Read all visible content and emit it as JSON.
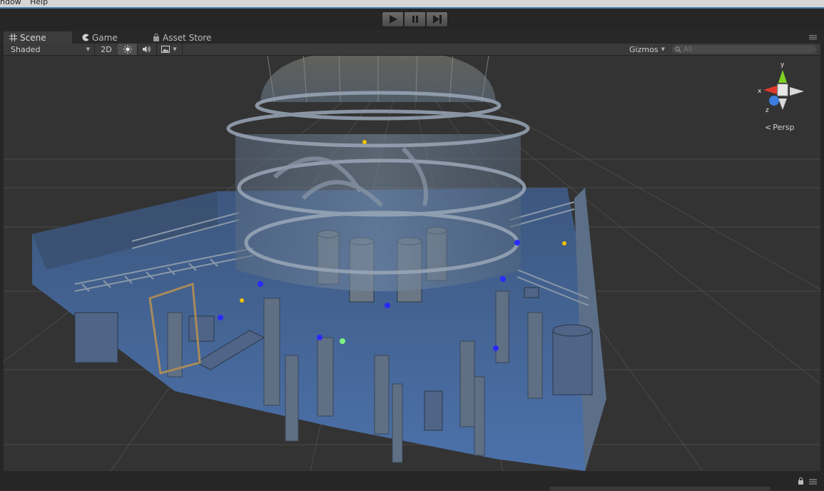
{
  "menu": {
    "items": [
      "ndow",
      "Help"
    ]
  },
  "play_controls": {
    "play": "play-icon",
    "pause": "pause-icon",
    "step": "step-icon"
  },
  "tabs": [
    {
      "label": "Scene",
      "icon": "scene-grid-icon",
      "active": true
    },
    {
      "label": "Game",
      "icon": "game-pacman-icon",
      "active": false
    },
    {
      "label": "Asset Store",
      "icon": "asset-store-bag-icon",
      "active": false
    }
  ],
  "scene_toolbar": {
    "render_mode": "Shaded",
    "mode_2d": "2D",
    "lighting_icon": "sun-icon",
    "audio_icon": "speaker-icon",
    "effects_icon": "image-icon",
    "gizmos_label": "Gizmos",
    "search_placeholder": "All"
  },
  "viewport": {
    "projection_label": "Persp",
    "axis_labels": {
      "x": "x",
      "y": "y",
      "z": "z"
    }
  },
  "colors": {
    "editor_bg": "#2b2b2b",
    "viewport_bg": "#333333",
    "axis_x": "#e0392b",
    "axis_y": "#7ed321",
    "axis_z": "#3b7de0",
    "selection": "#4d7fb4"
  }
}
